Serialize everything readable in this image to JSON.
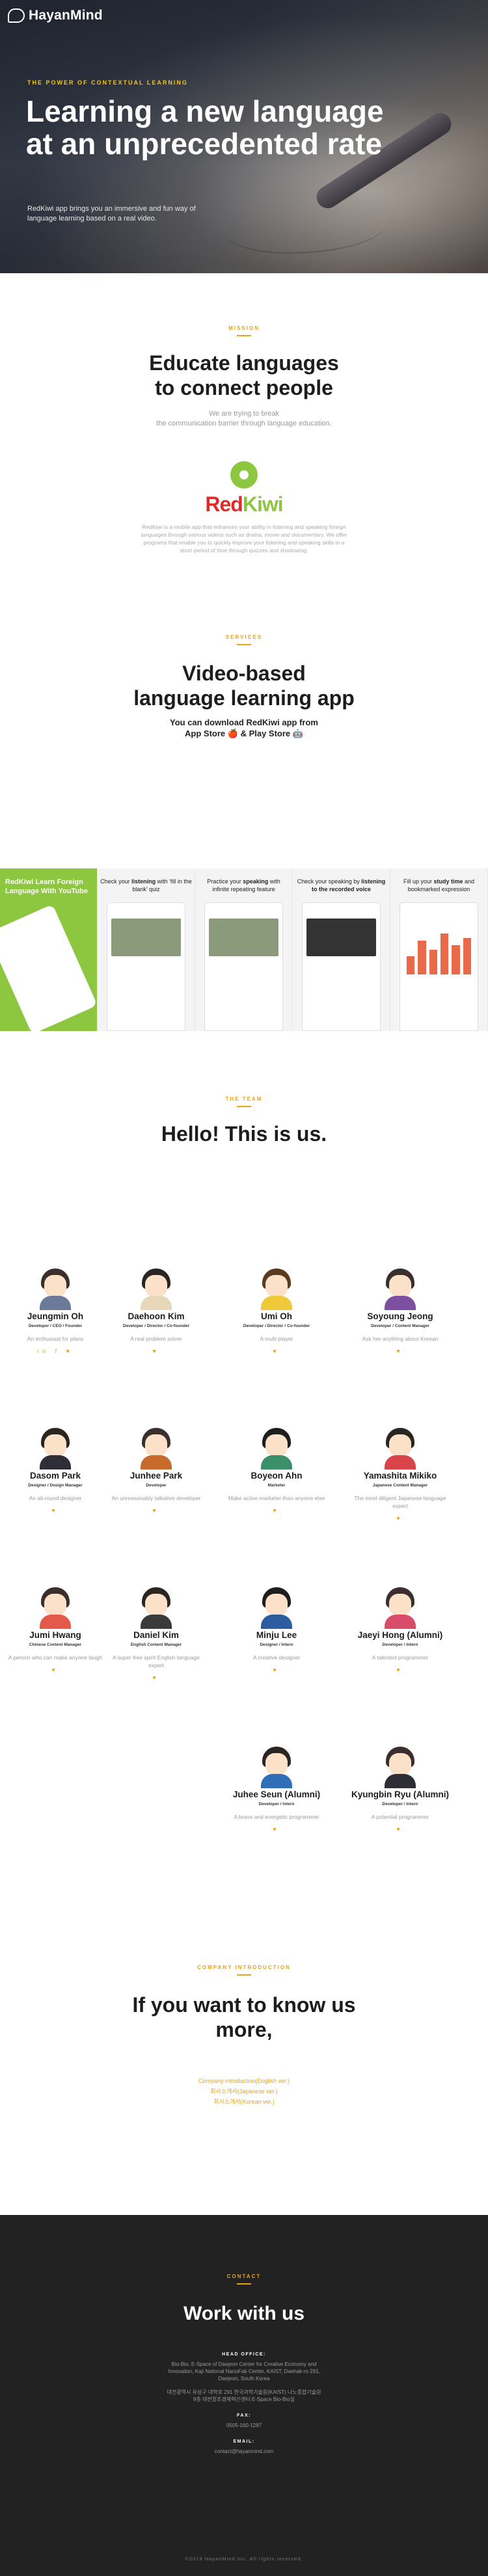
{
  "brand": {
    "name": "HayanMind"
  },
  "hero": {
    "kicker": "THE POWER OF CONTEXTUAL LEARNING",
    "title_line1": "Learning a new language",
    "title_line2": "at an unprecedented rate",
    "subtitle": "RedKiwi app brings you an immersive and fun way of language learning based on a real video."
  },
  "mission": {
    "label": "MISSION",
    "title_line1": "Educate languages",
    "title_line2": "to connect people",
    "tagline_line1": "We are trying to break",
    "tagline_line2": "the communication barrier through language education.",
    "product_red": "Red",
    "product_green": "Kiwi",
    "description": "RedKiwi is a mobile app that enhances your ability in listening and speaking foreign languages through various videos such as drama, movie and documentary. We offer programs that enable you to quickly improve your listening and speaking skills in a short period of time through quizzes and shadowing."
  },
  "services": {
    "label": "SERVICES",
    "title_line1": "Video-based",
    "title_line2": "language learning app",
    "download_line1": "You can download RedKiwi app from",
    "download_line2": "App Store 🍎 & Play Store 🤖",
    "shots": [
      {
        "caption": "RedKiwi Learn Foreign Language With YouTube"
      },
      {
        "caption_a": "Check your ",
        "caption_b": "listening",
        "caption_c": " with 'fill in the blank' quiz"
      },
      {
        "caption_a": "Practice your ",
        "caption_b": "speaking",
        "caption_c": " with infinite repeating feature"
      },
      {
        "caption_a": "Check your speaking by ",
        "caption_b": "listening to the recorded voice",
        "caption_c": ""
      },
      {
        "caption_a": "Fill up your ",
        "caption_b": "study time",
        "caption_c": " and bookmarked expression"
      }
    ]
  },
  "team": {
    "label": "THE TEAM",
    "title": "Hello! This is us.",
    "members": [
      {
        "name": "Jeungmin Oh",
        "role": "Developer / CEO / Founder",
        "bio": "An enthusiast for plans",
        "social": "in f ♥"
      },
      {
        "name": "Daehoon Kim",
        "role": "Developer / Director / Co-founder",
        "bio": "A real problem solver",
        "social": "♥"
      },
      {
        "name": "Umi Oh",
        "role": "Developer / Director / Co-founder",
        "bio": "A multi player",
        "social": "♥"
      },
      {
        "name": "Soyoung Jeong",
        "role": "Developer / Content Manager",
        "bio": "Ask her anything about Korean",
        "social": "♥"
      },
      {
        "name": "Dasom Park",
        "role": "Designer / Design Manager",
        "bio": "An all-round designer",
        "social": "♥"
      },
      {
        "name": "Junhee Park",
        "role": "Developer",
        "bio": "An unreasonably talkative developer",
        "social": "♥"
      },
      {
        "name": "Boyeon Ahn",
        "role": "Marketer",
        "bio": "Make active marketer than anyone else",
        "social": "♥"
      },
      {
        "name": "Yamashita Mikiko",
        "role": "Japanese Content Manager",
        "bio": "The most diligent Japanese language expert",
        "social": "♥"
      },
      {
        "name": "Jumi Hwang",
        "role": "Chinese Content Manager",
        "bio": "A person who can make anyone laugh",
        "social": "♥"
      },
      {
        "name": "Daniel Kim",
        "role": "English Content Manager",
        "bio": "A super free spirit English language expert",
        "social": "♥"
      },
      {
        "name": "Minju Lee",
        "role": "Designer / Intern",
        "bio": "A creative designer",
        "social": "♥"
      },
      {
        "name": "Jaeyi Hong (Alumni)",
        "role": "Developer / Intern",
        "bio": "A talented programmer",
        "social": "♥"
      },
      {
        "name": "Juhee Seun (Alumni)",
        "role": "Developer / Intern",
        "bio": "A brave and energetic programmer",
        "social": "♥"
      },
      {
        "name": "Kyungbin Ryu (Alumni)",
        "role": "Developer / Intern",
        "bio": "A potential programmer",
        "social": "♥"
      }
    ]
  },
  "company": {
    "label": "COMPANY INTRODUCTION",
    "title_line1": "If you want to know us",
    "title_line2": "more,",
    "links": [
      "Company introduction(English ver.)",
      "회사소개서(Japanese ver.)",
      "회사소개서(Korean ver.)"
    ]
  },
  "contact": {
    "label": "CONTACT",
    "title": "Work with us",
    "head_office_key": "HEAD OFFICE:",
    "head_office_en": "Bio-Bio, E-Space of Daejeon Center for Creative Economy and Innovation, Kaji National NanoFab Center, KAIST, Daehak-ro 291, Daejeon, South Korea",
    "head_office_kr": "대전광역시 유성구 대학로 291 한국과학기술원(KAIST) 나노종합기술원 9층 대전창조경제혁신센터 E-Space Bio-Bio실",
    "fax_key": "FAX:",
    "fax": "0505-160-1287",
    "email_key": "EMAIL:",
    "email": "contact@hayanmind.com",
    "copyright": "©2019 HayanMind Inc. All rights reserved."
  },
  "colors": {
    "accent": "#e8a317",
    "kiwi_green": "#8dc63f",
    "red": "#e02b2b",
    "footer_bg": "#222222"
  }
}
